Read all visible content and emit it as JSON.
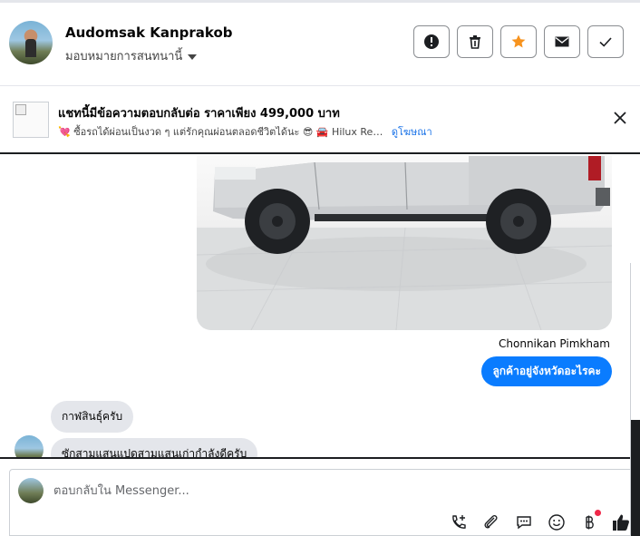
{
  "header": {
    "contact_name": "Audomsak Kanprakob",
    "assign_label": "มอบหมายการสนทนานี้",
    "actions": [
      {
        "name": "report-button",
        "icon": "alert-circle-icon"
      },
      {
        "name": "delete-button",
        "icon": "trash-icon"
      },
      {
        "name": "star-button",
        "icon": "star-icon"
      },
      {
        "name": "mark-unread-button",
        "icon": "envelope-icon"
      },
      {
        "name": "mark-done-button",
        "icon": "check-icon"
      }
    ]
  },
  "ad_banner": {
    "title": "แชทนี้มีข้อความตอบกลับต่อ ราคาเพียง 499,000 บาท",
    "subtitle": "💘 ซื้อรถได้ผ่อนเป็นงวด ๆ แต่รักคุณผ่อนตลอดชีวิตได้นะ 😎 🚘 Hilux Re…",
    "link": "ดูโฆษณา"
  },
  "conversation": {
    "sender_name": "Chonnikan Pimkham",
    "outgoing_message": "ลูกค้าอยู่จังหวัดอะไรคะ",
    "incoming_messages": [
      "กาฬสินธุ์ครับ",
      "ซักสามแสนแปดสามแสนเก่ากำลังดีครับ"
    ]
  },
  "composer": {
    "placeholder": "ตอบกลับใน Messenger..."
  },
  "colors": {
    "accent": "#0a7cff",
    "star": "#f7931e",
    "incoming_bubble": "#e4e6eb"
  }
}
